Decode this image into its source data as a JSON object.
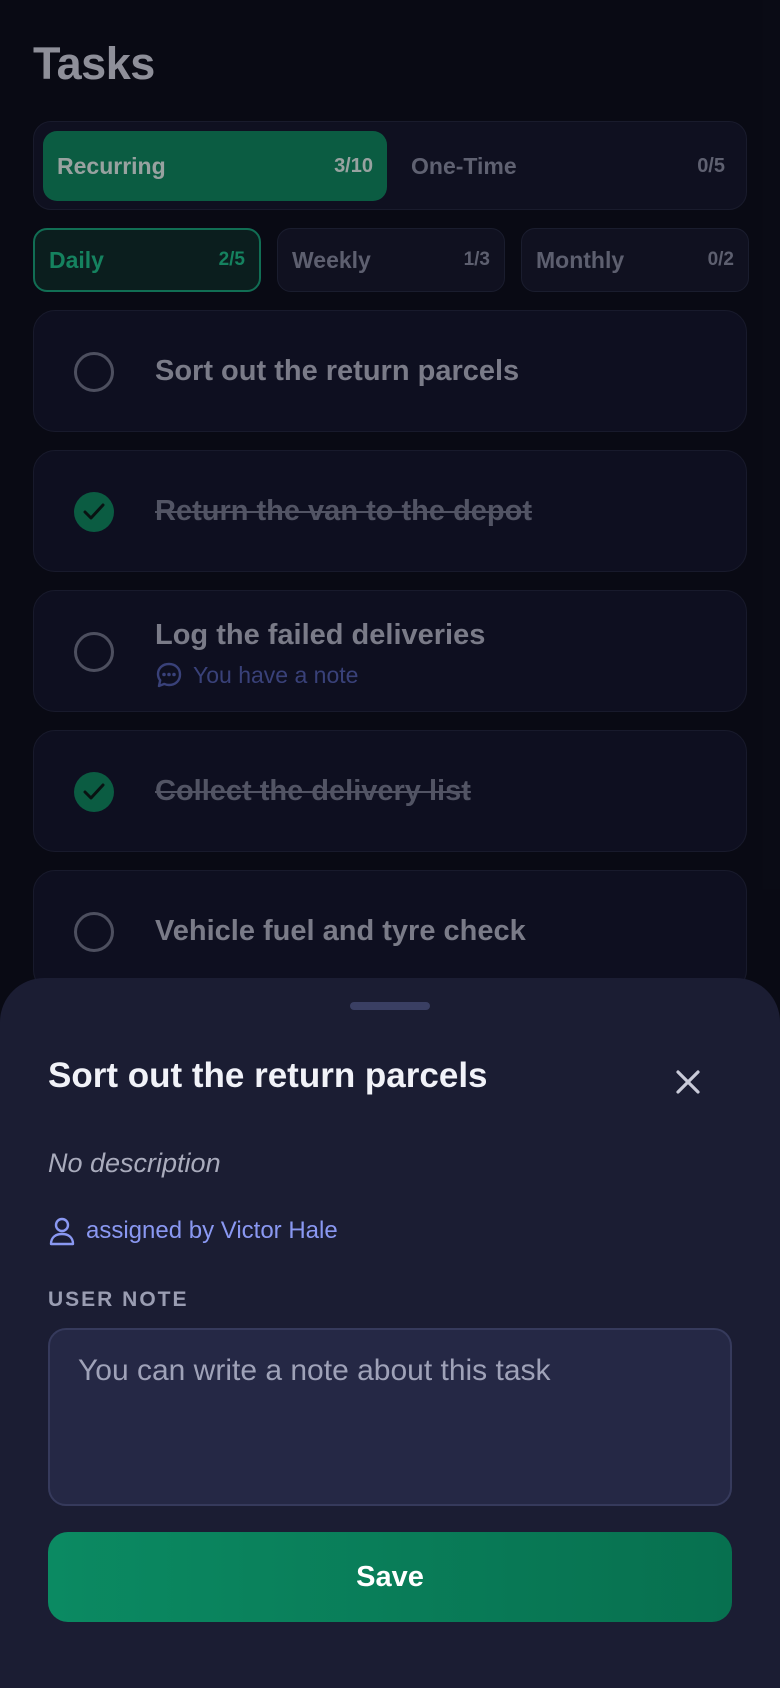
{
  "page": {
    "title": "Tasks"
  },
  "segments": [
    {
      "label": "Recurring",
      "count": "3/10",
      "active": true
    },
    {
      "label": "One-Time",
      "count": "0/5",
      "active": false
    }
  ],
  "periods": [
    {
      "label": "Daily",
      "count": "2/5",
      "active": true
    },
    {
      "label": "Weekly",
      "count": "1/3",
      "active": false
    },
    {
      "label": "Monthly",
      "count": "0/2",
      "active": false
    }
  ],
  "tasks": [
    {
      "title": "Sort out the return parcels",
      "done": false,
      "note": ""
    },
    {
      "title": "Return the van to the depot",
      "done": true,
      "note": ""
    },
    {
      "title": "Log the failed deliveries",
      "done": false,
      "note": "You have a note"
    },
    {
      "title": "Collect the delivery list",
      "done": true,
      "note": ""
    },
    {
      "title": "Vehicle fuel and tyre check",
      "done": false,
      "note": ""
    }
  ],
  "sheet": {
    "title": "Sort out the return parcels",
    "description": "No description",
    "assigned_by": "assigned by Victor Hale",
    "note_label": "USER NOTE",
    "note_placeholder": "You can write a note about this task",
    "note_value": "",
    "save_label": "Save"
  },
  "colors": {
    "accent": "#0e8a5f",
    "accent_text": "#1ec58b",
    "link": "#8a98f2",
    "background": "#0c0d18",
    "sheet": "#1b1d33"
  },
  "icons": {
    "check": "check-icon",
    "note": "chat-bubble-icon",
    "assignee": "user-icon",
    "close": "close-icon"
  }
}
